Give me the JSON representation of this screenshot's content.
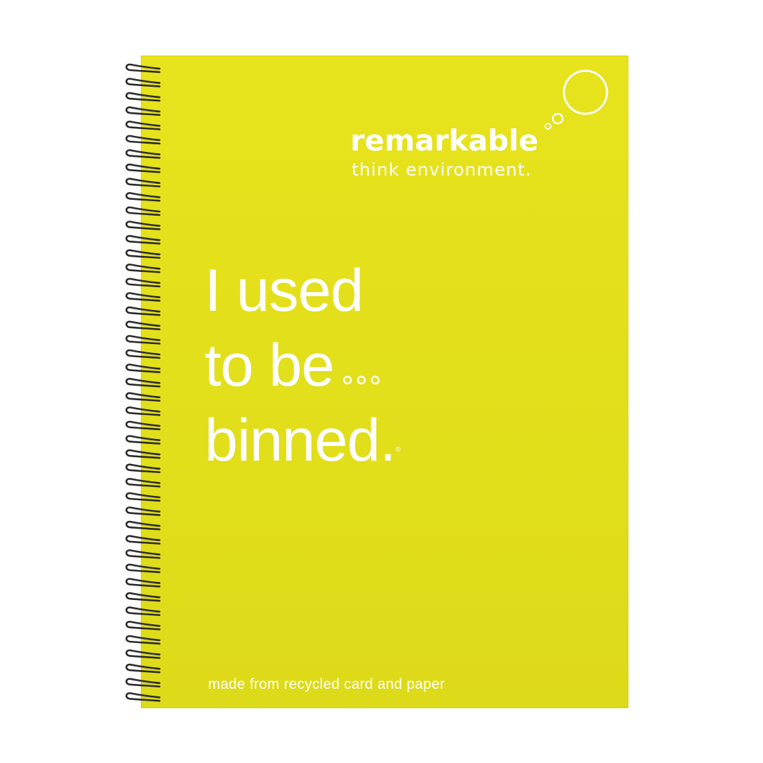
{
  "notebook": {
    "brand": "remarkable",
    "tagline": "think environment.",
    "headline": {
      "line1": "I used",
      "line2": "to be",
      "line3": "binned.",
      "registered_mark": "®"
    },
    "footer": "made from recycled card and paper",
    "colors": {
      "cover": "#e2df1b",
      "text": "#ffffff",
      "spiral": "#2a2a2a"
    }
  }
}
